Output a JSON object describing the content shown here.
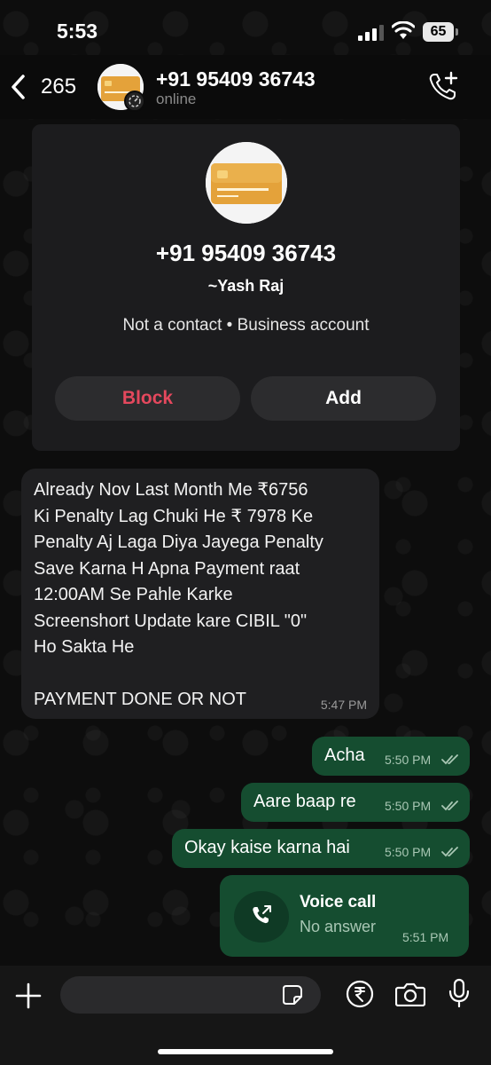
{
  "status_bar": {
    "time": "5:53",
    "battery": "65"
  },
  "header": {
    "back_count": "265",
    "contact_number": "+91 95409 36743",
    "status": "online"
  },
  "contact_card": {
    "phone": "+91 95409 36743",
    "name": "~Yash Raj",
    "info": "Not a contact • Business account",
    "block_label": "Block",
    "add_label": "Add"
  },
  "messages": {
    "incoming": {
      "text": "Already Nov Last Month Me ₹6756\nKi Penalty Lag Chuki He ₹ 7978 Ke\nPenalty Aj Laga Diya Jayega Penalty\nSave Karna H Apna Payment  raat\n12:00AM Se Pahle Karke\nScreenshort Update kare CIBIL \"0\"\nHo Sakta He\n\nPAYMENT DONE OR NOT",
      "time": "5:47 PM"
    },
    "outgoing": [
      {
        "text": "Acha",
        "time": "5:50 PM"
      },
      {
        "text": "Aare baap re",
        "time": "5:50 PM"
      },
      {
        "text": "Okay kaise karna hai",
        "time": "5:50 PM"
      }
    ],
    "voice_call": {
      "title": "Voice call",
      "subtitle": "No answer",
      "time": "5:51 PM"
    }
  },
  "input": {
    "placeholder": ""
  },
  "colors": {
    "outgoing_bubble": "#154d30",
    "block_red": "#e5485d",
    "incoming_bubble": "#1f1f21"
  },
  "icons": [
    "signal-icon",
    "wifi-icon",
    "battery-icon",
    "chevron-left-icon",
    "call-add-icon",
    "sticker-icon",
    "rupee-icon",
    "camera-icon",
    "mic-icon",
    "plus-icon",
    "double-check-icon",
    "outgoing-call-icon"
  ]
}
